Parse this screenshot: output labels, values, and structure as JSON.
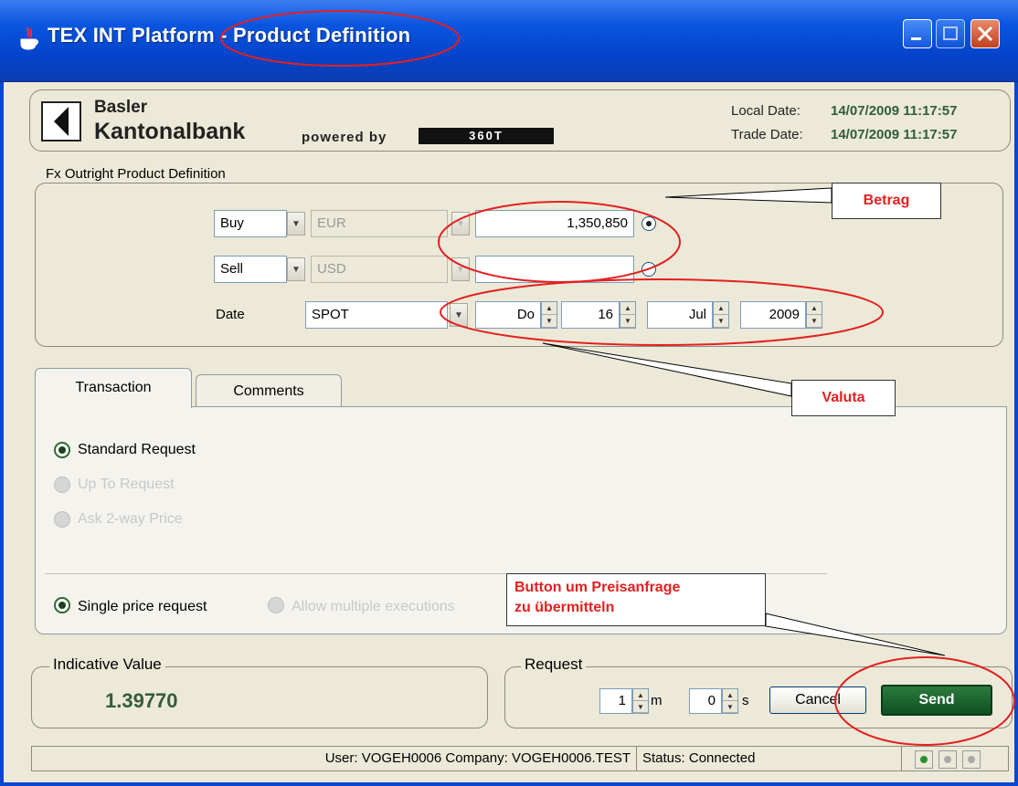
{
  "window": {
    "title": "TEX INT Platform - Product Definition"
  },
  "header": {
    "bank_line1": "Basler",
    "bank_line2": "Kantonalbank",
    "powered_by": "powered by",
    "logo_text": "360T",
    "local_date_label": "Local Date:",
    "local_date_value": "14/07/2009 11:17:57",
    "trade_date_label": "Trade Date:",
    "trade_date_value": "14/07/2009 11:17:57"
  },
  "fx": {
    "legend": "Fx Outright Product Definition",
    "row1": {
      "side": "Buy",
      "currency": "EUR",
      "amount": "1,350,850"
    },
    "row2": {
      "side": "Sell",
      "currency": "USD",
      "amount": ""
    },
    "date_label": "Date",
    "tenor": "SPOT",
    "day_name": "Do",
    "day": "16",
    "month": "Jul",
    "year": "2009"
  },
  "tabs": [
    {
      "label": "Transaction",
      "active": true
    },
    {
      "label": "Comments",
      "active": false
    }
  ],
  "transaction": {
    "standard_request": "Standard Request",
    "up_to_request": "Up To Request",
    "ask_two_way": "Ask 2-way Price",
    "single_price": "Single price request",
    "multiple_exec": "Allow multiple executions"
  },
  "indicative": {
    "legend": "Indicative Value",
    "value": "1.39770"
  },
  "request": {
    "legend": "Request",
    "minutes": "1",
    "minutes_unit": "m",
    "seconds": "0",
    "seconds_unit": "s",
    "cancel": "Cancel",
    "send": "Send"
  },
  "status": {
    "user": "User: VOGEH0006 Company: VOGEH0006.TEST",
    "state": "Status:  Connected"
  },
  "annotations": {
    "betrag": "Betrag",
    "valuta": "Valuta",
    "button_line1": "Button um Preisanfrage",
    "button_line2": "zu übermitteln",
    "color": "#e32020"
  }
}
